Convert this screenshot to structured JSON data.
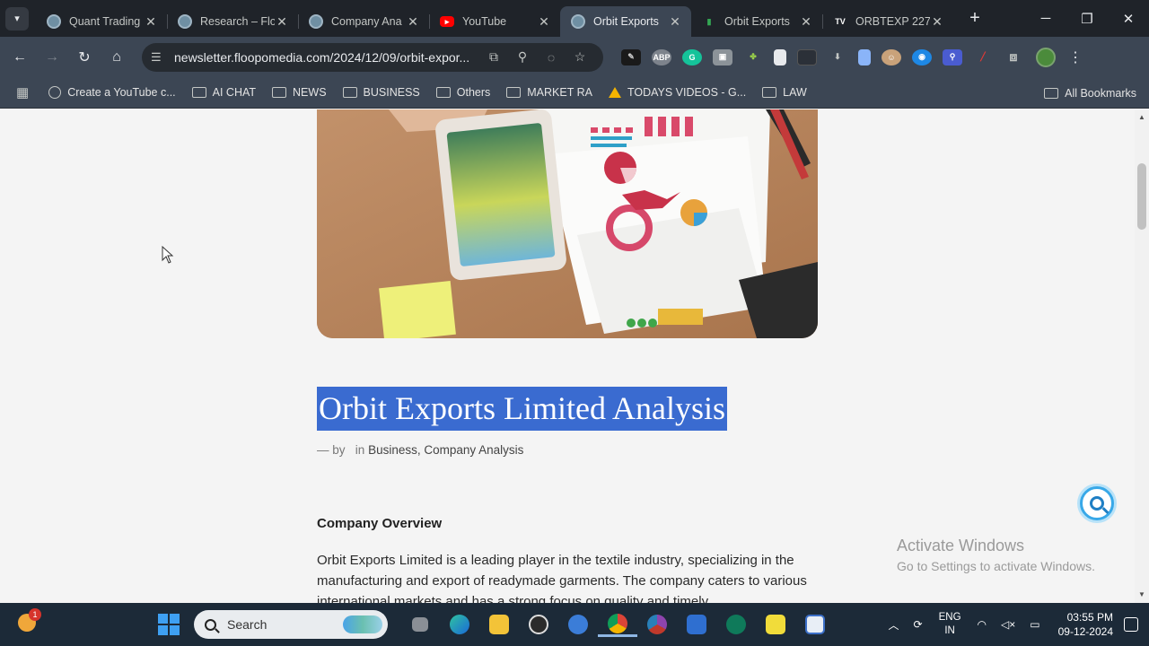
{
  "browser": {
    "tabs": [
      {
        "title": "Quant Trading",
        "icon": "globe-icon",
        "color": "#6f8fa3",
        "active": false
      },
      {
        "title": "Research – Flo",
        "icon": "globe-icon",
        "color": "#6f8fa3",
        "active": false
      },
      {
        "title": "Company Ana",
        "icon": "globe-icon",
        "color": "#6f8fa3",
        "active": false
      },
      {
        "title": "YouTube",
        "icon": "youtube-icon",
        "color": "#ff0000",
        "active": false
      },
      {
        "title": "Orbit Exports",
        "icon": "globe-icon",
        "color": "#6f8fa3",
        "active": true
      },
      {
        "title": "Orbit Exports",
        "icon": "sheets-chart-icon",
        "color": "#34a853",
        "active": false
      },
      {
        "title": "ORBTEXP 227",
        "icon": "tradingview-icon",
        "color": "#ffffff",
        "active": false
      }
    ],
    "tab_close": "✕",
    "new_tab": "+",
    "url": "newsletter.floopomedia.com/2024/12/09/orbit-expor...",
    "bookmarks": [
      {
        "label": "Create a YouTube c...",
        "icon": "globe-icon"
      },
      {
        "label": "AI CHAT",
        "icon": "folder-icon"
      },
      {
        "label": "NEWS",
        "icon": "folder-icon"
      },
      {
        "label": "BUSINESS",
        "icon": "folder-icon"
      },
      {
        "label": "Others",
        "icon": "folder-icon"
      },
      {
        "label": "MARKET RA",
        "icon": "folder-icon"
      },
      {
        "label": "TODAYS VIDEOS - G...",
        "icon": "drive-icon"
      },
      {
        "label": "LAW",
        "icon": "folder-icon"
      }
    ],
    "all_bookmarks": "All Bookmarks"
  },
  "article": {
    "title": "Orbit Exports Limited Analysis",
    "meta_by": "— by",
    "meta_in": "in",
    "categories": "Business, Company Analysis",
    "section_heading": "Company Overview",
    "paragraph": "Orbit Exports Limited is a leading player in the textile industry, specializing in the manufacturing and export of readymade garments. The company caters to various international markets and has a strong focus on quality and timely"
  },
  "activation": {
    "line1": "Activate Windows",
    "line2": "Go to Settings to activate Windows."
  },
  "taskbar": {
    "weather_badge": "1",
    "search_label": "Search",
    "lang_line1": "ENG",
    "lang_line2": "IN",
    "time": "03:55 PM",
    "date": "09-12-2024"
  },
  "colors": {
    "selection": "#3a6bd0",
    "tabstrip": "#1f2329",
    "toolbar": "#3c4654",
    "taskbar": "#1c2a38"
  }
}
